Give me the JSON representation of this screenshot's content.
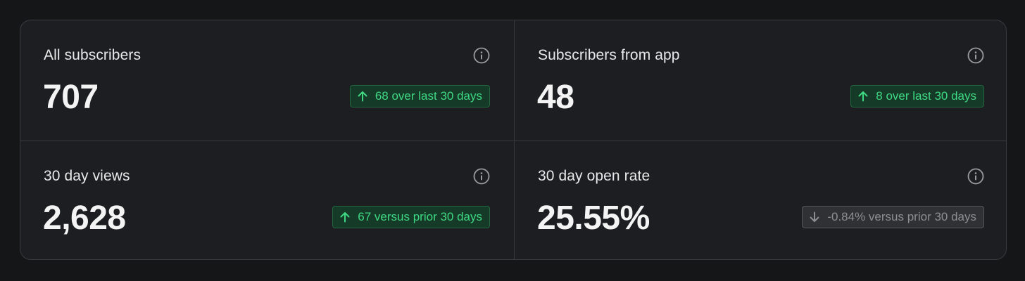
{
  "stats": [
    {
      "title": "All subscribers",
      "value": "707",
      "trend": {
        "direction": "up",
        "icon": "arrow-up-icon",
        "text": "68 over last 30 days"
      }
    },
    {
      "title": "Subscribers from app",
      "value": "48",
      "trend": {
        "direction": "up",
        "icon": "arrow-up-icon",
        "text": "8 over last 30 days"
      }
    },
    {
      "title": "30 day views",
      "value": "2,628",
      "trend": {
        "direction": "up",
        "icon": "arrow-up-icon",
        "text": "67 versus prior 30 days"
      }
    },
    {
      "title": "30 day open rate",
      "value": "25.55%",
      "trend": {
        "direction": "down",
        "icon": "arrow-down-icon",
        "text": "-0.84% versus prior 30 days"
      }
    }
  ],
  "icons": {
    "info": "info-icon"
  },
  "colors": {
    "positive": "#3fd883",
    "neutral": "#8d8e92",
    "panel": "#1d1e21",
    "background": "#151618"
  }
}
